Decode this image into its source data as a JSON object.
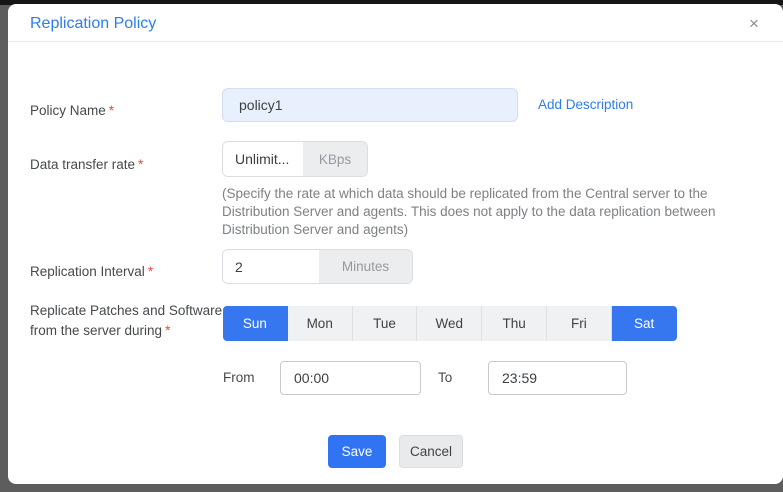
{
  "dialog": {
    "title": "Replication Policy",
    "close_icon": "×"
  },
  "form": {
    "policy_name": {
      "label": "Policy Name",
      "required_marker": "*",
      "value": "policy1",
      "add_description_label": "Add Description"
    },
    "data_transfer_rate": {
      "label": "Data transfer rate",
      "required_marker": "*",
      "value": "Unlimit...",
      "unit": "KBps",
      "hint": "(Specify the rate at which data should be replicated from the Central server to the Distribution Server and agents. This does not apply to the data replication between Distribution Server and agents)"
    },
    "replication_interval": {
      "label": "Replication Interval",
      "required_marker": "*",
      "value": "2",
      "unit": "Minutes"
    },
    "replication_days": {
      "label_line1": "Replicate Patches and Software",
      "label_line2": "from the server during",
      "required_marker": "*",
      "days": [
        {
          "label": "Sun",
          "selected": true
        },
        {
          "label": "Mon",
          "selected": false
        },
        {
          "label": "Tue",
          "selected": false
        },
        {
          "label": "Wed",
          "selected": false
        },
        {
          "label": "Thu",
          "selected": false
        },
        {
          "label": "Fri",
          "selected": false
        },
        {
          "label": "Sat",
          "selected": true
        }
      ]
    },
    "time_range": {
      "from_label": "From",
      "from_value": "00:00",
      "to_label": "To",
      "to_value": "23:59"
    }
  },
  "footer": {
    "save_label": "Save",
    "cancel_label": "Cancel"
  },
  "colors": {
    "title_blue": "#2e7cf0",
    "link_blue": "#2e7cf0",
    "selected_day_blue": "#3677f0",
    "save_blue": "#3074f3",
    "required_red": "#e5484d",
    "autofill_input_bg": "#e8f0fe"
  }
}
